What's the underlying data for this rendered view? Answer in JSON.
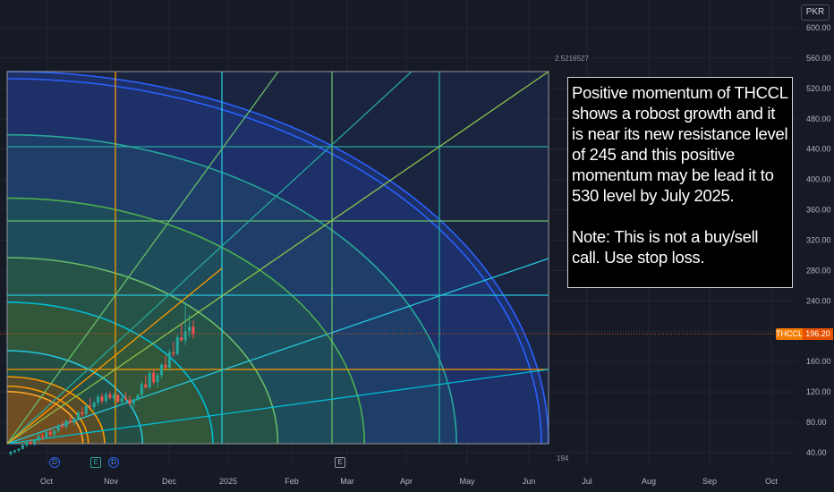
{
  "chart_data": {
    "type": "candlestick",
    "symbol": "THCCL",
    "currency": "PKR",
    "last_price": "196.20",
    "y_axis": {
      "range": [
        40,
        600
      ],
      "ticks": [
        "600.00",
        "560.00",
        "520.00",
        "480.00",
        "440.00",
        "400.00",
        "360.00",
        "320.00",
        "280.00",
        "240.00",
        "200.00",
        "160.00",
        "120.00",
        "80.00",
        "40.00"
      ]
    },
    "x_axis": {
      "ticks": [
        "Oct",
        "Nov",
        "Dec",
        "2025",
        "Feb",
        "Mar",
        "Apr",
        "May",
        "Jun",
        "Jul",
        "Aug",
        "Sep",
        "Oct"
      ]
    },
    "gann_fan_levels": [
      "2.5216527",
      "194"
    ],
    "candles": [
      [
        38,
        42,
        36,
        41
      ],
      [
        41,
        44,
        39,
        43
      ],
      [
        43,
        46,
        41,
        45
      ],
      [
        45,
        52,
        44,
        50
      ],
      [
        50,
        56,
        47,
        54
      ],
      [
        54,
        58,
        50,
        52
      ],
      [
        52,
        57,
        49,
        56
      ],
      [
        56,
        64,
        54,
        62
      ],
      [
        62,
        66,
        57,
        60
      ],
      [
        60,
        69,
        58,
        67
      ],
      [
        67,
        72,
        62,
        64
      ],
      [
        64,
        70,
        61,
        69
      ],
      [
        69,
        78,
        66,
        76
      ],
      [
        76,
        82,
        72,
        74
      ],
      [
        74,
        84,
        71,
        82
      ],
      [
        82,
        88,
        78,
        80
      ],
      [
        80,
        86,
        76,
        85
      ],
      [
        85,
        95,
        83,
        93
      ],
      [
        93,
        100,
        88,
        91
      ],
      [
        91,
        104,
        89,
        102
      ],
      [
        102,
        112,
        98,
        100
      ],
      [
        100,
        108,
        96,
        106
      ],
      [
        106,
        116,
        102,
        114
      ],
      [
        114,
        118,
        104,
        108
      ],
      [
        108,
        120,
        105,
        117
      ],
      [
        117,
        121,
        110,
        112
      ],
      [
        112,
        119,
        108,
        116
      ],
      [
        116,
        118,
        105,
        107
      ],
      [
        107,
        114,
        103,
        112
      ],
      [
        112,
        120,
        108,
        110
      ],
      [
        110,
        115,
        102,
        104
      ],
      [
        104,
        112,
        100,
        110
      ],
      [
        110,
        118,
        108,
        116
      ],
      [
        116,
        134,
        114,
        130
      ],
      [
        130,
        142,
        124,
        126
      ],
      [
        126,
        148,
        124,
        145
      ],
      [
        145,
        150,
        130,
        133
      ],
      [
        133,
        145,
        126,
        142
      ],
      [
        142,
        158,
        138,
        156
      ],
      [
        156,
        168,
        150,
        152
      ],
      [
        152,
        176,
        148,
        172
      ],
      [
        172,
        186,
        166,
        170
      ],
      [
        170,
        196,
        168,
        192
      ],
      [
        192,
        210,
        186,
        188
      ],
      [
        188,
        238,
        182,
        200
      ],
      [
        200,
        222,
        192,
        206
      ],
      [
        206,
        214,
        190,
        196
      ]
    ],
    "annotation": {
      "text": "Positive momentum of THCCL shows a robost growth and it is near its new resistance level of 245 and this positive momentum may be lead it to 530 level by July 2025.",
      "note": "Note: This is not a buy/sell call. Use stop loss."
    },
    "events": {
      "dividend": "D",
      "earnings": "E",
      "economic": "E"
    },
    "grid": true
  }
}
